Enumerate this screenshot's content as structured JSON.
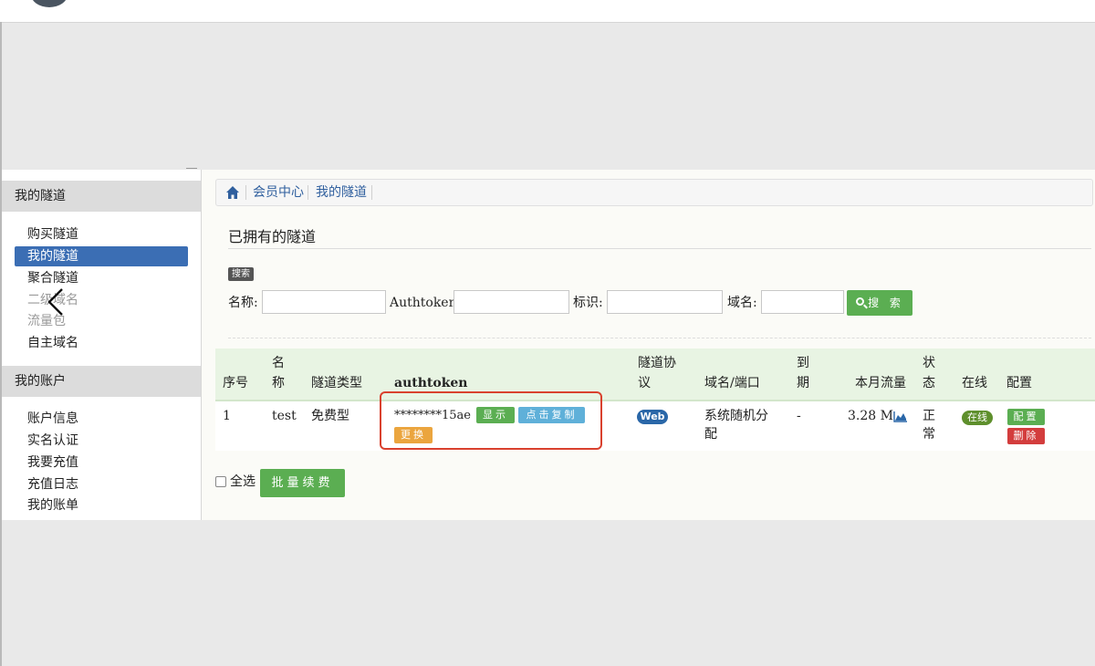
{
  "sidebar": {
    "tunnels_heading": "我的隧道",
    "tunnel_items": [
      {
        "label": "购买隧道"
      },
      {
        "label": "我的隧道"
      },
      {
        "label": "聚合隧道"
      },
      {
        "label": "二级域名"
      },
      {
        "label": "流量包"
      },
      {
        "label": "自主域名"
      }
    ],
    "account_heading": "我的账户",
    "account_items": [
      {
        "label": "账户信息"
      },
      {
        "label": "实名认证"
      },
      {
        "label": "我要充值"
      },
      {
        "label": "充值日志"
      },
      {
        "label": "我的账单"
      }
    ]
  },
  "breadcrumb": [
    "会员中心",
    "我的隧道"
  ],
  "page_title": "已拥有的隧道",
  "search": {
    "badge": "搜索",
    "name_label": "名称:",
    "authtoken_label": "Authtoken:",
    "tag_label": "标识:",
    "domain_label": "域名:",
    "button": "搜 索"
  },
  "table": {
    "headers": {
      "index": "序号",
      "name_1": "名",
      "name_2": "称",
      "type": "隧道类型",
      "authtoken": "authtoken",
      "protocol_1": "隧道协",
      "protocol_2": "议",
      "domain": "域名/端口",
      "expire_1": "到",
      "expire_2": "期",
      "traffic": "本月流量",
      "status_1": "状",
      "status_2": "态",
      "online": "在线",
      "config": "配置"
    },
    "rows": [
      {
        "index": "1",
        "name": "test",
        "type": "免费型",
        "authtoken": "********15ae",
        "btn_show": "显示",
        "btn_copy": "点击复制",
        "btn_change": "更换",
        "protocol": "Web",
        "domain_1": "系统随机分",
        "domain_2": "配",
        "expire": "-",
        "traffic": "3.28 M",
        "status_1": "正",
        "status_2": "常",
        "online": "在线",
        "btn_config": "配置",
        "btn_delete": "删除"
      }
    ]
  },
  "select_all": "全选",
  "batch_renew": "批量续费",
  "colors": {
    "primary": "#3b6eb4",
    "green": "#5bae52",
    "blue": "#5fb0d9",
    "orange": "#eba53e",
    "red": "#d33d3d",
    "highlight": "#d9412e"
  }
}
